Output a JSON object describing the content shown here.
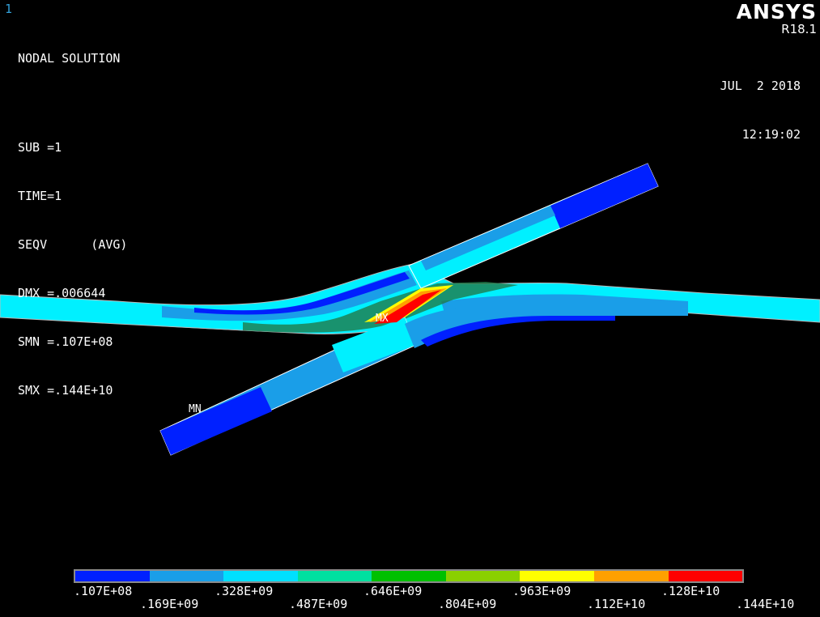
{
  "window_id": "1",
  "info": {
    "title": "NODAL SOLUTION",
    "lines": [
      "SUB =1",
      "TIME=1",
      "SEQV      (AVG)",
      "DMX =.006644",
      "SMN =.107E+08",
      "SMX =.144E+10"
    ]
  },
  "brand": {
    "name": "ANSYS",
    "version": "R18.1"
  },
  "stamp": {
    "date": "JUL  2 2018",
    "time": "12:19:02"
  },
  "markers": {
    "max": "MX",
    "min": "MN"
  },
  "legend": {
    "colors": [
      "#0020ff",
      "#1a9ee8",
      "#00e0ff",
      "#00e0a0",
      "#00c000",
      "#8ad000",
      "#ffff00",
      "#ffa000",
      "#ff0000"
    ],
    "ticks": [
      ".107E+08",
      ".169E+09",
      ".328E+09",
      ".487E+09",
      ".646E+09",
      ".804E+09",
      ".963E+09",
      ".112E+10",
      ".128E+10",
      ".144E+10"
    ]
  }
}
